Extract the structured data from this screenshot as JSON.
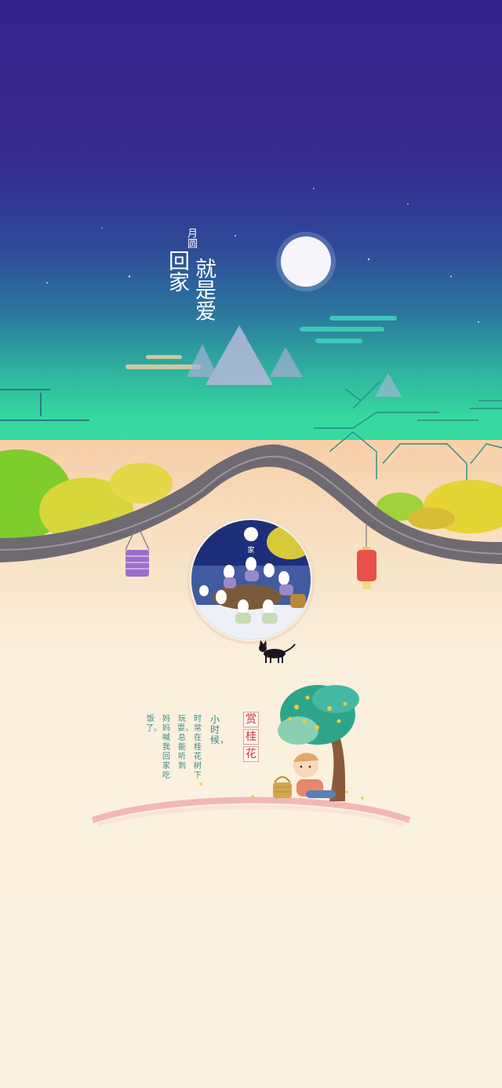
{
  "poster": {
    "title_small": "月圆",
    "title_col_right": "回家",
    "title_col_left": "就是爱",
    "window_label": "家",
    "poem_title": "赏桂花",
    "poem_lines": [
      "小时候，",
      "时常在桂花树下",
      "玩耍，总能听到",
      "妈妈喊我回家吃",
      "饭了。"
    ]
  },
  "colors": {
    "sky_top": "#35228a",
    "sky_bottom": "#3ce39e",
    "moon": "#ffffff",
    "wall_top": "#6f6a72",
    "ground": "#faf3e2",
    "lantern_red": "#e8504a",
    "lantern_purple": "#9a6ec8",
    "poem_text": "#3a8a86",
    "poem_title": "#c23c3c"
  },
  "icons": [
    "moon-icon",
    "cloud-icon",
    "mountain-icon",
    "lantern-icon",
    "cat-icon",
    "tree-icon",
    "child-icon",
    "basket-icon"
  ]
}
